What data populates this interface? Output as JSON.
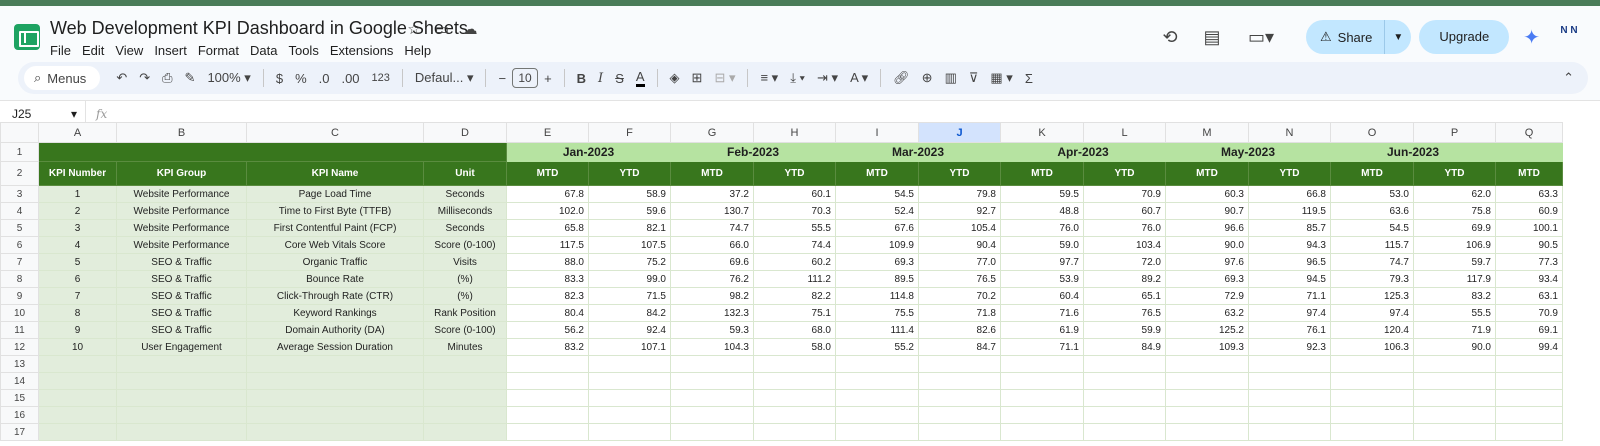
{
  "app": {
    "title": "Web Development KPI Dashboard in Google Sheets",
    "menu": [
      "File",
      "Edit",
      "View",
      "Insert",
      "Format",
      "Data",
      "Tools",
      "Extensions",
      "Help"
    ],
    "share_label": "Share",
    "upgrade_label": "Upgrade",
    "avatar_text": "N N"
  },
  "toolbar": {
    "search_label": "Menus",
    "zoom": "100%",
    "currency": "$",
    "percent": "%",
    "dec_decrease": ".0",
    "dec_increase": ".00",
    "number_format": "123",
    "font": "Defaul...",
    "font_size": "10"
  },
  "formula_bar": {
    "cell_ref": "J25",
    "fx": "fx"
  },
  "sheet": {
    "columns": [
      "A",
      "B",
      "C",
      "D",
      "E",
      "F",
      "G",
      "H",
      "I",
      "J",
      "K",
      "L",
      "M",
      "N",
      "O",
      "P",
      "Q"
    ],
    "selected_column": "J",
    "row_numbers": [
      "1",
      "2",
      "3",
      "4",
      "5",
      "6",
      "7",
      "8",
      "9",
      "10",
      "11",
      "12",
      "13",
      "14",
      "15",
      "16",
      "17"
    ],
    "headers": [
      "KPI Number",
      "KPI Group",
      "KPI Name",
      "Unit"
    ],
    "months": [
      "Jan-2023",
      "Feb-2023",
      "Mar-2023",
      "Apr-2023",
      "May-2023",
      "Jun-2023"
    ],
    "sub_headers": [
      "MTD",
      "YTD",
      "MTD",
      "YTD",
      "MTD",
      "YTD",
      "MTD",
      "YTD",
      "MTD",
      "YTD",
      "MTD",
      "YTD",
      "MTD"
    ],
    "rows": [
      {
        "num": "1",
        "group": "Website Performance",
        "name": "Page Load Time",
        "unit": "Seconds",
        "values": [
          "67.8",
          "58.9",
          "37.2",
          "60.1",
          "54.5",
          "79.8",
          "59.5",
          "70.9",
          "60.3",
          "66.8",
          "53.0",
          "62.0",
          "63.3"
        ]
      },
      {
        "num": "2",
        "group": "Website Performance",
        "name": "Time to First Byte (TTFB)",
        "unit": "Milliseconds",
        "values": [
          "102.0",
          "59.6",
          "130.7",
          "70.3",
          "52.4",
          "92.7",
          "48.8",
          "60.7",
          "90.7",
          "119.5",
          "63.6",
          "75.8",
          "60.9"
        ]
      },
      {
        "num": "3",
        "group": "Website Performance",
        "name": "First Contentful Paint (FCP)",
        "unit": "Seconds",
        "values": [
          "65.8",
          "82.1",
          "74.7",
          "55.5",
          "67.6",
          "105.4",
          "76.0",
          "76.0",
          "96.6",
          "85.7",
          "54.5",
          "69.9",
          "100.1"
        ]
      },
      {
        "num": "4",
        "group": "Website Performance",
        "name": "Core Web Vitals Score",
        "unit": "Score (0-100)",
        "values": [
          "117.5",
          "107.5",
          "66.0",
          "74.4",
          "109.9",
          "90.4",
          "59.0",
          "103.4",
          "90.0",
          "94.3",
          "115.7",
          "106.9",
          "90.5"
        ]
      },
      {
        "num": "5",
        "group": "SEO & Traffic",
        "name": "Organic Traffic",
        "unit": "Visits",
        "values": [
          "88.0",
          "75.2",
          "69.6",
          "60.2",
          "69.3",
          "77.0",
          "97.7",
          "72.0",
          "97.6",
          "96.5",
          "74.7",
          "59.7",
          "77.3"
        ]
      },
      {
        "num": "6",
        "group": "SEO & Traffic",
        "name": "Bounce Rate",
        "unit": "(%)",
        "values": [
          "83.3",
          "99.0",
          "76.2",
          "111.2",
          "89.5",
          "76.5",
          "53.9",
          "89.2",
          "69.3",
          "94.5",
          "79.3",
          "117.9",
          "93.4"
        ]
      },
      {
        "num": "7",
        "group": "SEO & Traffic",
        "name": "Click-Through Rate (CTR)",
        "unit": "(%)",
        "values": [
          "82.3",
          "71.5",
          "98.2",
          "82.2",
          "114.8",
          "70.2",
          "60.4",
          "65.1",
          "72.9",
          "71.1",
          "125.3",
          "83.2",
          "63.1"
        ]
      },
      {
        "num": "8",
        "group": "SEO & Traffic",
        "name": "Keyword Rankings",
        "unit": "Rank Position",
        "values": [
          "80.4",
          "84.2",
          "132.3",
          "75.1",
          "75.5",
          "71.8",
          "71.6",
          "76.5",
          "63.2",
          "97.4",
          "97.4",
          "55.5",
          "70.9"
        ]
      },
      {
        "num": "9",
        "group": "SEO & Traffic",
        "name": "Domain Authority (DA)",
        "unit": "Score (0-100)",
        "values": [
          "56.2",
          "92.4",
          "59.3",
          "68.0",
          "111.4",
          "82.6",
          "61.9",
          "59.9",
          "125.2",
          "76.1",
          "120.4",
          "71.9",
          "69.1"
        ]
      },
      {
        "num": "10",
        "group": "User Engagement",
        "name": "Average Session Duration",
        "unit": "Minutes",
        "values": [
          "83.2",
          "107.1",
          "104.3",
          "58.0",
          "55.2",
          "84.7",
          "71.1",
          "84.9",
          "109.3",
          "92.3",
          "106.3",
          "90.0",
          "99.4"
        ]
      }
    ]
  },
  "colors": {
    "header_dark_green": "#38761d",
    "month_light_green": "#b6e3a1",
    "meta_fill": "#e2eddc",
    "selected_col": "#d3e3fd"
  }
}
